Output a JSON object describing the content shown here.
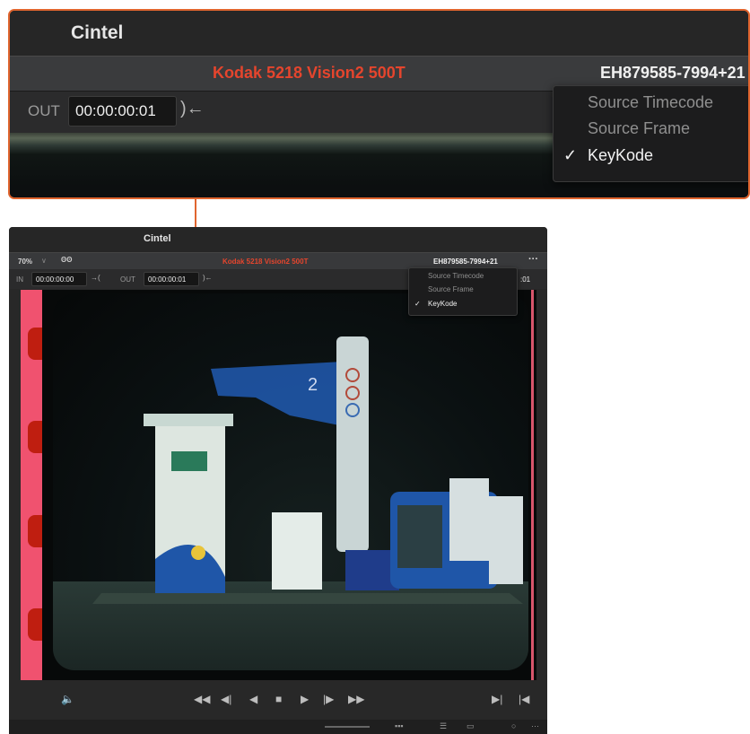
{
  "callout": {
    "title": "Cintel",
    "film_stock": "Kodak 5218 Vision2 500T",
    "keykode_value": "EH879585-7994+21",
    "out_label": "OUT",
    "out_timecode": "00:00:00:01",
    "out_mark": ")←",
    "menu": {
      "items": [
        {
          "label": "Source Timecode",
          "checked": false
        },
        {
          "label": "Source Frame",
          "checked": false
        },
        {
          "label": "KeyKode",
          "checked": true
        }
      ],
      "check_glyph": "✓"
    }
  },
  "viewer": {
    "title": "Cintel",
    "zoom": "70%",
    "zoom_chevron": "∨",
    "loop_glyph": "ʘʘ",
    "film_stock": "Kodak 5218 Vision2 500T",
    "keykode_value": "EH879585-7994+21",
    "more_glyph": "···",
    "in_label": "IN",
    "in_timecode": "00:00:00:00",
    "in_mark": "→(",
    "out_label": "OUT",
    "out_timecode": "00:00:00:01",
    "out_mark": ")←",
    "timecode_tail": ":01",
    "menu": {
      "items": [
        {
          "label": "Source Timecode",
          "checked": false
        },
        {
          "label": "Source Frame",
          "checked": false
        },
        {
          "label": "KeyKode",
          "checked": true
        }
      ],
      "check_glyph": "✓"
    },
    "transport": {
      "volume": "🔈",
      "first_frame": "◀◀",
      "prev_frame": "◀|",
      "reverse": "◀",
      "stop": "■",
      "play": "▶",
      "next_frame": "|▶",
      "fast_forward": "▶▶",
      "prev_clip": "▶|",
      "next_clip": "|◀"
    },
    "colors": {
      "accent": "#e0652f",
      "film_stock": "#e5452d",
      "sprocket_strip": "#f0526f",
      "sprocket_hole": "#bf1e10"
    }
  }
}
